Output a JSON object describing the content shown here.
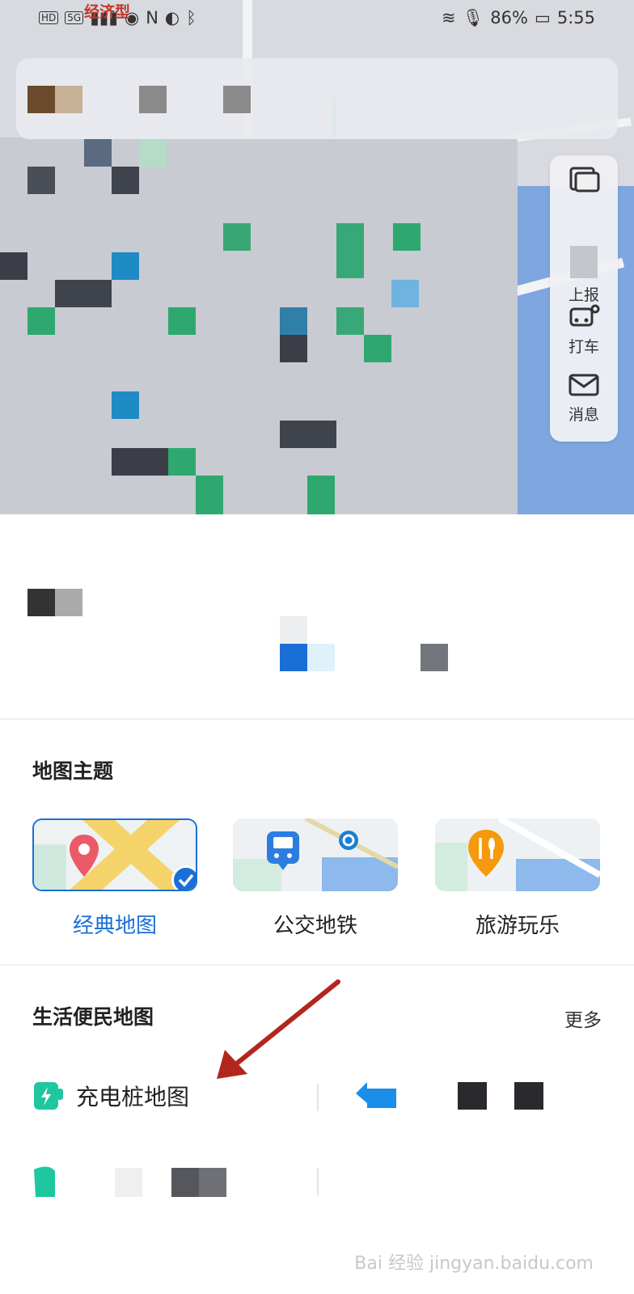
{
  "status_bar": {
    "left_badges": [
      "HD",
      "5G"
    ],
    "battery": "86%",
    "time": "5:55"
  },
  "map": {
    "overlay_label": "经济型",
    "side_panel": [
      {
        "label": "上报",
        "icon": "report-icon"
      },
      {
        "label": "打车",
        "icon": "taxi-icon"
      },
      {
        "label": "消息",
        "icon": "message-icon"
      }
    ],
    "top_icon": "layers-icon"
  },
  "themes": {
    "title": "地图主题",
    "items": [
      {
        "label": "经典地图",
        "icon": "location-pin-icon",
        "selected": true
      },
      {
        "label": "公交地铁",
        "icon": "bus-icon",
        "selected": false
      },
      {
        "label": "旅游玩乐",
        "icon": "restaurant-icon",
        "selected": false
      }
    ]
  },
  "life": {
    "title": "生活便民地图",
    "more": "更多",
    "items": [
      {
        "label": "充电桩地图",
        "icon": "charging-station-icon"
      }
    ]
  },
  "watermark": "Bai 经验 jingyan.baidu.com",
  "colors": {
    "accent": "#1a6fd6",
    "water": "#7ea6df",
    "green": "#37a877",
    "arrow": "#b3261e"
  }
}
